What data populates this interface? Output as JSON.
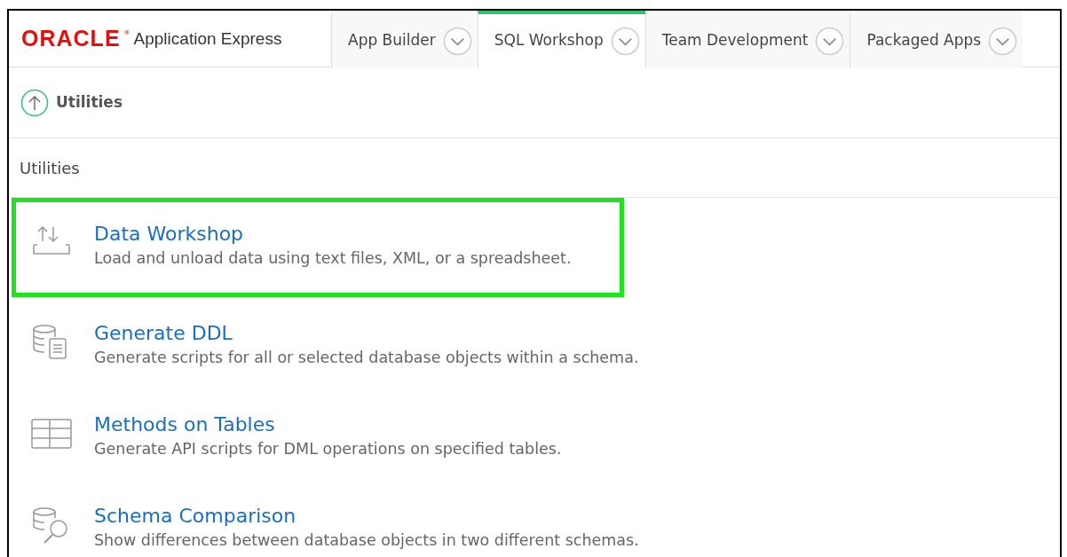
{
  "header": {
    "logo_word": "ORACLE",
    "logo_mark": "®",
    "product": "Application Express"
  },
  "tabs": [
    {
      "label": "App Builder",
      "selected": false
    },
    {
      "label": "SQL Workshop",
      "selected": true
    },
    {
      "label": "Team Development",
      "selected": false
    },
    {
      "label": "Packaged Apps",
      "selected": false
    }
  ],
  "breadcrumb": {
    "label": "Utilities"
  },
  "region_title": "Utilities",
  "items": [
    {
      "kind": "load",
      "title": "Data Workshop",
      "description": "Load and unload data using text files, XML, or a spreadsheet.",
      "highlighted": true
    },
    {
      "kind": "ddl",
      "title": "Generate DDL",
      "description": "Generate scripts for all or selected database objects within a schema.",
      "highlighted": false
    },
    {
      "kind": "table",
      "title": "Methods on Tables",
      "description": "Generate API scripts for DML operations on specified tables.",
      "highlighted": false
    },
    {
      "kind": "compare",
      "title": "Schema Comparison",
      "description": "Show differences between database objects in two different schemas.",
      "highlighted": false
    }
  ]
}
